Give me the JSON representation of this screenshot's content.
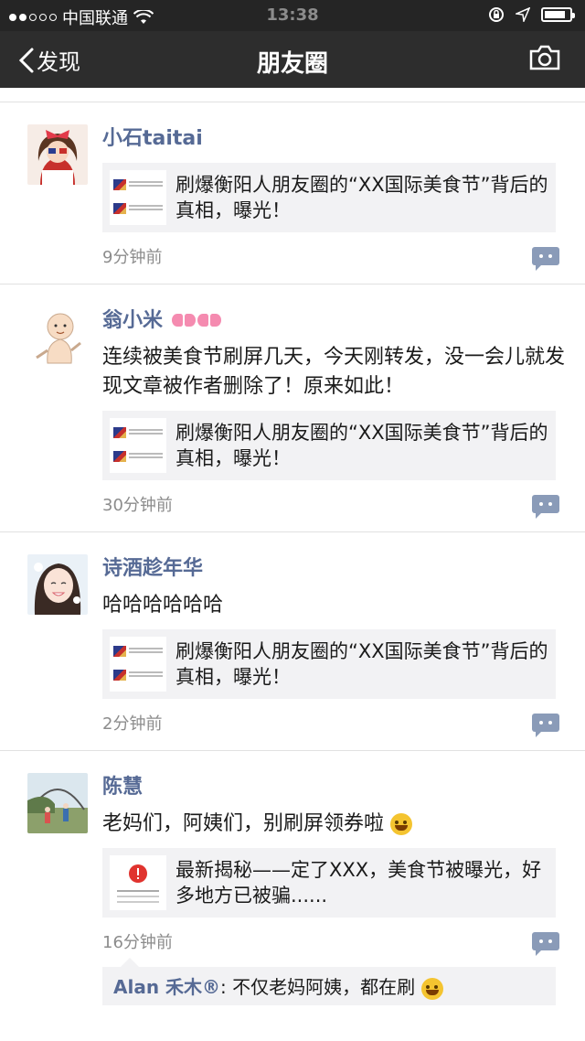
{
  "status": {
    "carrier": "中国联通",
    "time": "13:38"
  },
  "nav": {
    "back_label": "发现",
    "title": "朋友圈"
  },
  "posts": [
    {
      "username": "小石taitai",
      "text": "",
      "link_title": "刷爆衡阳人朋友圈的“XX国际美食节”背后的真相，曝光！",
      "time": "9分钟前"
    },
    {
      "username": "翁小米",
      "text": "连续被美食节刷屏几天，今天刚转发，没一会儿就发现文章被作者删除了！原来如此！",
      "link_title": "刷爆衡阳人朋友圈的“XX国际美食节”背后的真相，曝光！",
      "time": "30分钟前"
    },
    {
      "username": "诗酒趁年华",
      "text": "哈哈哈哈哈哈",
      "link_title": "刷爆衡阳人朋友圈的“XX国际美食节”背后的真相，曝光！",
      "time": "2分钟前"
    },
    {
      "username": "陈慧",
      "text": "老妈们，阿姨们，别刷屏领券啦",
      "link_title": "最新揭秘——定了XXX，美食节被曝光，好多地方已被骗......",
      "time": "16分钟前",
      "comment": {
        "author": "Alan 禾木®",
        "text": ": 不仅老妈阿姨，都在刷"
      }
    }
  ],
  "icons": {
    "back": "chevron-left-icon",
    "camera": "camera-icon",
    "comment": "comment-icon",
    "wifi": "wifi-icon"
  },
  "colors": {
    "username": "#566a95",
    "navbar": "#2d2d2d",
    "comment_button": "#8a9bb8"
  },
  "battery_level": 0.85
}
